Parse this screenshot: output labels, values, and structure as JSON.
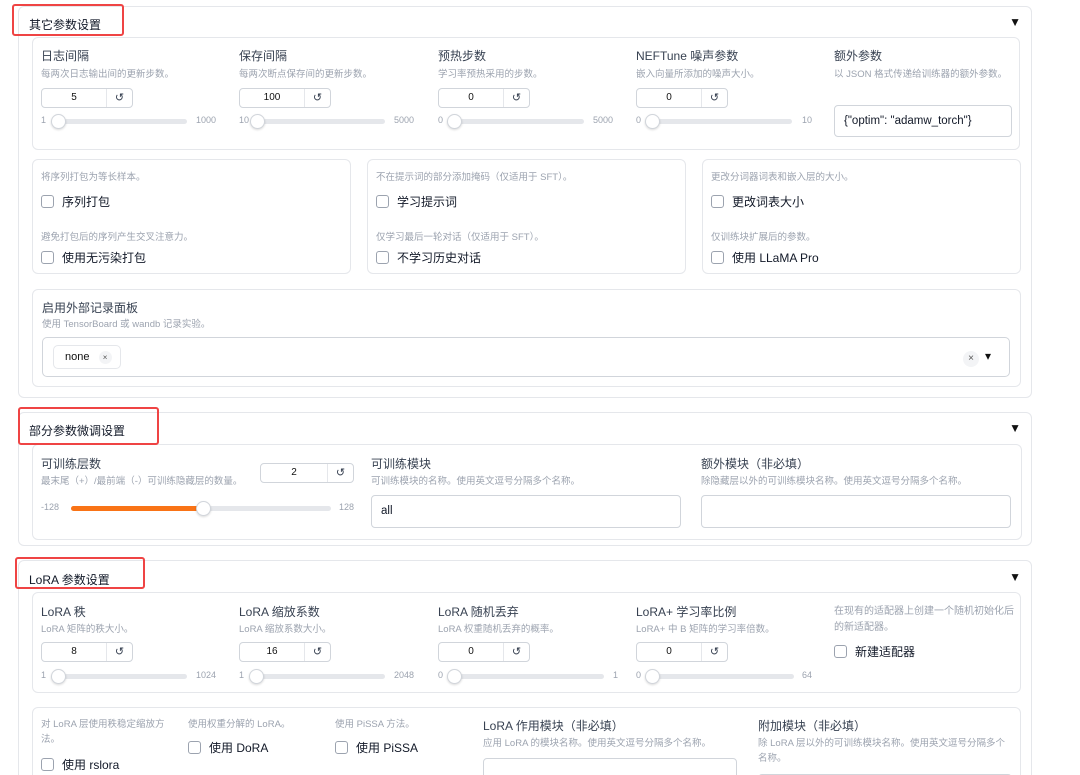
{
  "sections": {
    "other": {
      "title": "其它参数设置",
      "arrow": "▼",
      "logging_steps": {
        "label": "日志间隔",
        "info": "每两次日志输出间的更新步数。",
        "value": "5",
        "min": "1",
        "max": "1000",
        "level": 0.004
      },
      "save_steps": {
        "label": "保存间隔",
        "info": "每两次断点保存间的更新步数。",
        "value": "100",
        "min": "10",
        "max": "5000",
        "level": 0.018
      },
      "warmup_steps": {
        "label": "预热步数",
        "info": "学习率预热采用的步数。",
        "value": "0",
        "min": "0",
        "max": "5000",
        "level": 0
      },
      "neftune_alpha": {
        "label": "NEFTune 噪声参数",
        "info": "嵌入向量所添加的噪声大小。",
        "value": "0",
        "min": "0",
        "max": "10",
        "level": 0
      },
      "extra_args": {
        "label": "额外参数",
        "info": "以 JSON 格式传递给训练器的额外参数。",
        "value": "{\"optim\": \"adamw_torch\"}"
      },
      "packing": {
        "info": "将序列打包为等长样本。",
        "label": "序列打包"
      },
      "neat_packing": {
        "info": "避免打包后的序列产生交叉注意力。",
        "label": "使用无污染打包"
      },
      "train_on_prompt": {
        "info": "不在提示词的部分添加掩码（仅适用于 SFT）。",
        "label": "学习提示词"
      },
      "mask_history": {
        "info": "仅学习最后一轮对话（仅适用于 SFT）。",
        "label": "不学习历史对话"
      },
      "resize_vocab": {
        "info": "更改分词器词表和嵌入层的大小。",
        "label": "更改词表大小"
      },
      "use_llama_pro": {
        "info": "仅训练块扩展后的参数。",
        "label": "使用 LLaMA Pro"
      },
      "report_to": {
        "label": "启用外部记录面板",
        "info": "使用 TensorBoard 或 wandb 记录实验。",
        "chip": "none",
        "chip_x": "×",
        "clear": "×",
        "dropdown": "▾"
      }
    },
    "freeze": {
      "title": "部分参数微调设置",
      "arrow": "▼",
      "trainable_layers": {
        "label": "可训练层数",
        "info": "最末尾（+）/最前端（-）可训练隐藏层的数量。",
        "value": "2",
        "min": "-128",
        "max": "128",
        "level": 0.508
      },
      "trainable_modules": {
        "label": "可训练模块",
        "info": "可训练模块的名称。使用英文逗号分隔多个名称。",
        "value": "all"
      },
      "extra_modules": {
        "label": "额外模块（非必填）",
        "info": "除隐藏层以外的可训练模块名称。使用英文逗号分隔多个名称。",
        "value": ""
      }
    },
    "lora": {
      "title": "LoRA 参数设置",
      "arrow": "▼",
      "lora_rank": {
        "label": "LoRA 秩",
        "info": "LoRA 矩阵的秩大小。",
        "value": "8",
        "min": "1",
        "max": "1024",
        "level": 0.007
      },
      "lora_alpha": {
        "label": "LoRA 缩放系数",
        "info": "LoRA 缩放系数大小。",
        "value": "16",
        "min": "1",
        "max": "2048",
        "level": 0.007
      },
      "lora_dropout": {
        "label": "LoRA 随机丢弃",
        "info": "LoRA 权重随机丢弃的概率。",
        "value": "0",
        "min": "0",
        "max": "1",
        "level": 0
      },
      "loraplus_lr_ratio": {
        "label": "LoRA+ 学习率比例",
        "info": "LoRA+ 中 B 矩阵的学习率倍数。",
        "value": "0",
        "min": "0",
        "max": "64",
        "level": 0
      },
      "create_new_adapter": {
        "info": "在现有的适配器上创建一个随机初始化后的新适配器。",
        "label": "新建适配器"
      },
      "use_rslora": {
        "info": "对 LoRA 层使用秩稳定缩放方法。",
        "label": "使用 rslora"
      },
      "use_dora": {
        "info": "使用权重分解的 LoRA。",
        "label": "使用 DoRA"
      },
      "use_pissa": {
        "info": "使用 PiSSA 方法。",
        "label": "使用 PiSSA"
      },
      "lora_target": {
        "label": "LoRA 作用模块（非必填）",
        "info": "应用 LoRA 的模块名称。使用英文逗号分隔多个名称。",
        "value": ""
      },
      "additional_target": {
        "label": "附加模块（非必填）",
        "info": "除 LoRA 层以外的可训练模块名称。使用英文逗号分隔多个名称。",
        "value": ""
      }
    }
  },
  "colors": {
    "accent": "#f97316",
    "highlight": "#ef4444",
    "border": "#e5e7eb"
  },
  "icons": {
    "reset": "reset-icon",
    "arrow": "collapse-arrow-icon"
  }
}
